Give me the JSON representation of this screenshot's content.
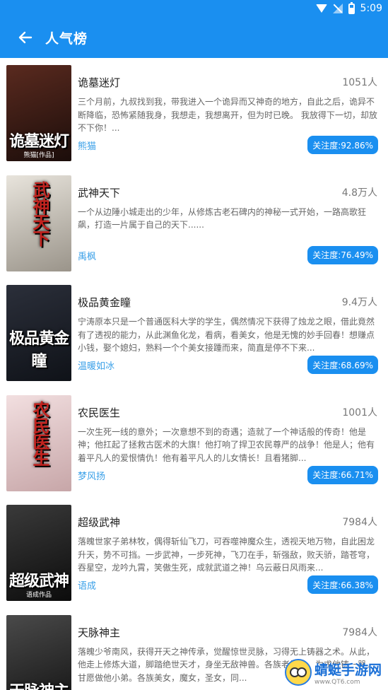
{
  "status_bar": {
    "time": "5:09",
    "icons": [
      "wifi-icon",
      "no-sim-icon",
      "battery-icon"
    ]
  },
  "app_bar": {
    "back_icon": "arrow-left-icon",
    "title": "人气榜"
  },
  "books": [
    {
      "title": "诡墓迷灯",
      "readers": "1051人",
      "description": "三个月前，九叔找到我，带我进入一个诡异而又神奇的地方，自此之后，诡异不断降临，恐怖紧随我身，我想走，我想离开，但为时已晚。\n      我放得下一切，却放不下你！...",
      "author": "熊猫",
      "attention": "关注度:92.86%",
      "cover_text": "诡墓迷灯",
      "cover_sub": "熊猫[作品]",
      "cover_colors": [
        "#5a2a1f",
        "#1b0d0a"
      ]
    },
    {
      "title": "武神天下",
      "readers": "4.8万人",
      "description": "一个从边陲小城走出的少年，从修炼古老石碑内的神秘一式开始，一路高歌狂飙，打造一片属于自己的天下......",
      "author": "禹枫",
      "attention": "关注度:76.49%",
      "cover_text": "武神天下",
      "cover_colors": [
        "#e8e4dc",
        "#9a948a"
      ]
    },
    {
      "title": "极品黄金瞳",
      "readers": "9.4万人",
      "description": "宁涛原本只是一个普通医科大学的学生，偶然情况下获得了烛龙之眼，借此竟然有了透视的能力，从此渊鱼化龙，看病，看美女，他是无愧的妙手回春！想赚点小钱，娶个媳妇，熟料一个个美女接踵而来，简直是停不下来...",
      "author": "温暖如冰",
      "attention": "关注度:68.69%",
      "cover_text": "极品黄金瞳",
      "cover_colors": [
        "#2b2f3a",
        "#0f1218"
      ]
    },
    {
      "title": "农民医生",
      "readers": "1001人",
      "description": "一次生死一线的意外；一次意想不到的奇遇；造就了一个神话般的传奇！他是神；他扛起了拯救古医术的大旗！他打响了捍卫农民尊严的战争！他是人；他有着平凡人的爱恨情仇！他有着平凡人的儿女情长！且看猪脚...",
      "author": "梦风扬",
      "attention": "关注度:66.71%",
      "cover_text": "农民医生",
      "cover_colors": [
        "#f2dfe0",
        "#c7a6a8"
      ]
    },
    {
      "title": "超级武神",
      "readers": "7984人",
      "description": "落魄世家子弟林牧，偶得斩仙飞刀，可吞噬神魔众生，透视天地万物，自此困龙升天，势不可挡。一步武神，一步死神，飞刀在手，斩强敌，败天骄，踏苍穹，吞星空，龙吟九霄，笑傲生死，成就武道之神！乌云蔽日风雨来...",
      "author": "语成",
      "attention": "关注度:66.38%",
      "cover_text": "超级武神",
      "cover_sub": "语成作品",
      "cover_colors": [
        "#3a3a3a",
        "#0c0c0c"
      ]
    },
    {
      "title": "天脉神主",
      "readers": "7984人",
      "description": "落魄少爷南风，获得开天之神传承，觉醒惊世灵脉，习得无上铸器之术。从此，他走上修炼大道，脚踏绝世天才，身坐无敌神兽。各族老怪物，为求他铸一器，甘愿做他小弟。各族美女，魔女，圣女，同...",
      "author": "",
      "attention": "",
      "cover_text": "天脉神主",
      "cover_colors": [
        "#4a4a4a",
        "#121212"
      ]
    }
  ],
  "watermark": {
    "main": "蜻蜓手游网",
    "sub": "www.QT6.com"
  }
}
